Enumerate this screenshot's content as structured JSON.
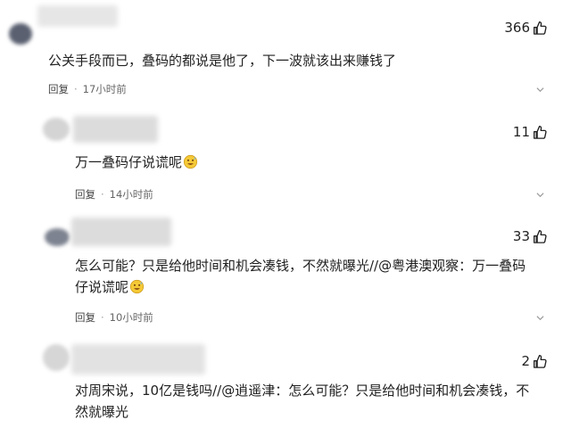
{
  "comments": [
    {
      "likes": "366",
      "text": "公关手段而已，叠码的都说是他了，下一波就该出来赚钱了",
      "reply_label": "回复",
      "time": "17小时前"
    },
    {
      "likes": "11",
      "text": "万一叠码仔说谎呢",
      "reply_label": "回复",
      "time": "14小时前"
    },
    {
      "likes": "33",
      "text_before": "怎么可能？只是给他时间和机会凑钱，不然就曝光//",
      "mention": "@粤港澳观察",
      "text_after": "：万一叠码仔说谎呢",
      "reply_label": "回复",
      "time": "10小时前"
    },
    {
      "likes": "2",
      "text_before": "对周宋说，10亿是钱吗//",
      "mention": "@逍遥津",
      "text_after": "：怎么可能？只是给他时间和机会凑钱，不然就曝光"
    }
  ],
  "icons": {
    "like": "thumbs-up-icon",
    "emoji": "sweat-smile-emoji-icon",
    "more": "chevron-down-icon"
  }
}
